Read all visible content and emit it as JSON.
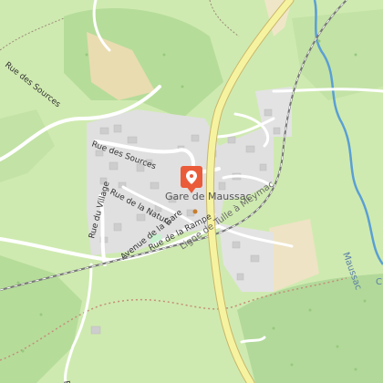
{
  "map": {
    "station": {
      "name": "Gare de Maussac",
      "marker_icon": "location-pin-icon",
      "marker_color": "#ea5b3a"
    },
    "streets": {
      "rue_des_sources_nw": "Rue des Sources",
      "rue_des_sources": "Rue des Sources",
      "rue_du_village": "Rue du Village",
      "rue_de_la_nature": "Rue de la Nature",
      "avenue_de_la_gare": "Avenue de la Gare",
      "rue_de_la_rampe": "Rue de la Rampe",
      "rue_bottom_left": "Ro"
    },
    "railway": {
      "name": "Ligne de Tulle à Meymac"
    },
    "river": {
      "name": "Maussac",
      "edge_letter": "C"
    },
    "colors": {
      "meadow": "#cfeab0",
      "forest": "#b6dc9a",
      "residential": "#e0e0e0",
      "building": "#cdcdcd",
      "main_road": "#f6f3a0",
      "main_road_casing": "#c9b66a",
      "rail": "#777777",
      "river": "#5a9fd4",
      "park": "#c7f0cf",
      "farmland": "#e9dcb0"
    }
  }
}
